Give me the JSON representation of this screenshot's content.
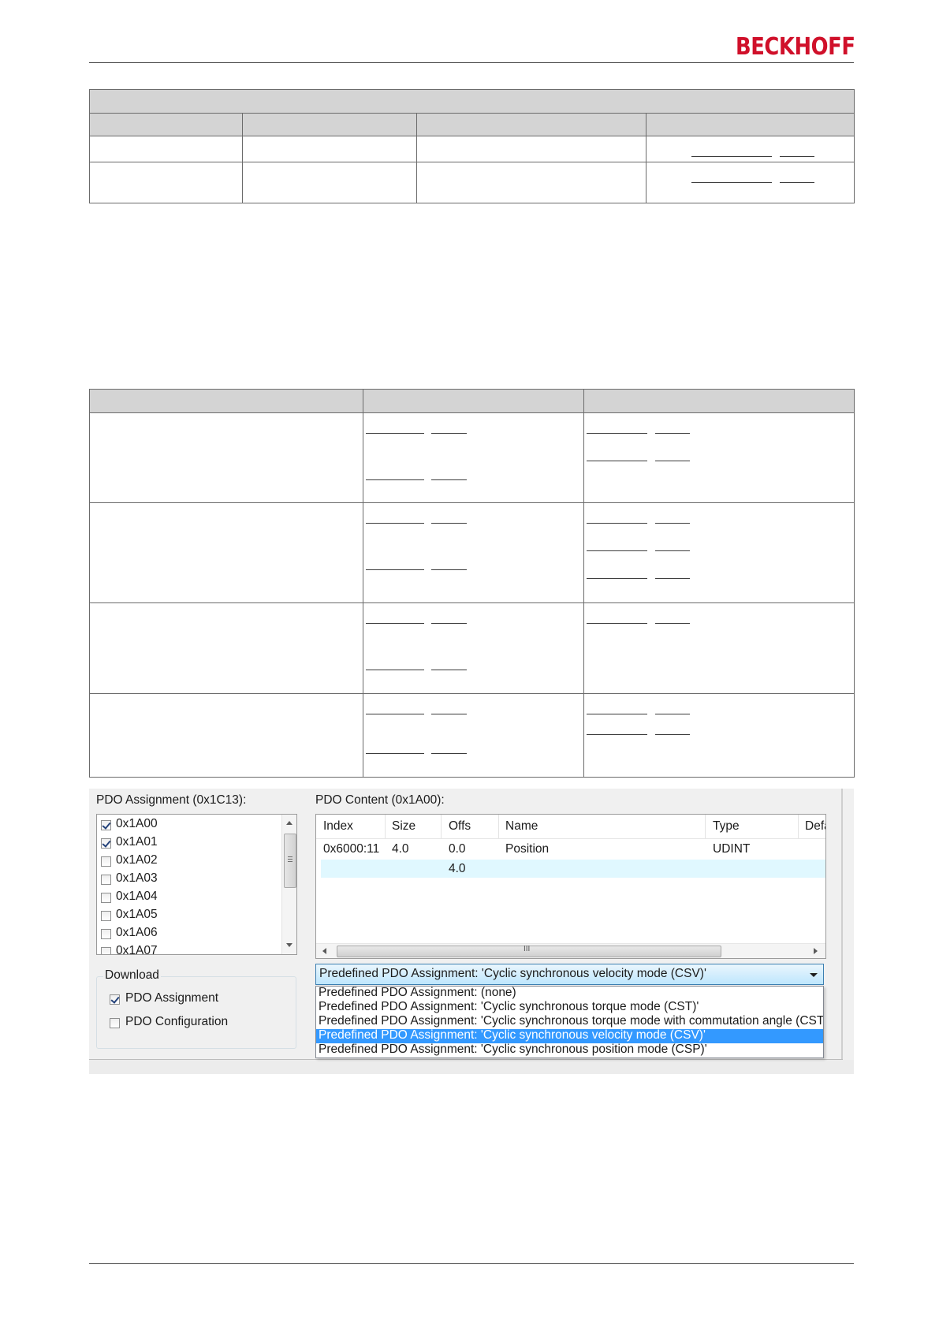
{
  "header": {
    "brand": "BECKHOFF"
  },
  "table1": {
    "rows": 3,
    "columns": 4
  },
  "table2": {
    "rows": 4,
    "columns": 3
  },
  "dialog": {
    "pdo_assignment_label": "PDO Assignment (0x1C13):",
    "pdo_content_label": "PDO Content (0x1A00):",
    "assignment_list": [
      {
        "label": "0x1A00",
        "checked": true
      },
      {
        "label": "0x1A01",
        "checked": true
      },
      {
        "label": "0x1A02",
        "checked": false
      },
      {
        "label": "0x1A03",
        "checked": false
      },
      {
        "label": "0x1A04",
        "checked": false
      },
      {
        "label": "0x1A05",
        "checked": false
      },
      {
        "label": "0x1A06",
        "checked": false
      },
      {
        "label": "0x1A07",
        "checked": false
      }
    ],
    "content_columns": [
      "Index",
      "Size",
      "Offs",
      "Name",
      "Type",
      "Defa"
    ],
    "content_rows": [
      {
        "index": "0x6000:11",
        "size": "4.0",
        "offs": "0.0",
        "name": "Position",
        "type": "UDINT"
      },
      {
        "index": "",
        "size": "",
        "offs": "4.0",
        "name": "",
        "type": ""
      }
    ],
    "hscroll_grip": "III",
    "download": {
      "title": "Download",
      "pdo_assignment": {
        "label": "PDO Assignment",
        "checked": true
      },
      "pdo_configuration": {
        "label": "PDO Configuration",
        "checked": false
      }
    },
    "combo_selected": "Predefined PDO Assignment: 'Cyclic synchronous velocity mode (CSV)'",
    "combo_options": [
      "Predefined PDO Assignment: (none)",
      "Predefined PDO Assignment: 'Cyclic synchronous torque mode (CST)'",
      "Predefined PDO Assignment: 'Cyclic synchronous torque mode with commutation angle (CSTCA)'",
      "Predefined PDO Assignment: 'Cyclic synchronous velocity mode (CSV)'",
      "Predefined PDO Assignment: 'Cyclic synchronous position mode (CSP)'"
    ],
    "combo_highlight_index": 3,
    "colors": {
      "selection": "#3399ff",
      "row_highlight": "#e0f8ff",
      "brand": "#d0102a"
    }
  }
}
